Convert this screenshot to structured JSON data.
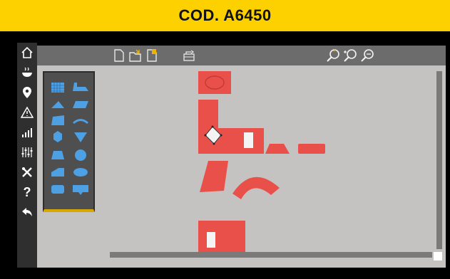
{
  "banner": {
    "title": "COD. A6450",
    "color": "#fdd000"
  },
  "left_toolbar": {
    "items": [
      {
        "icon": "home-icon"
      },
      {
        "icon": "bowl-steam-icon"
      },
      {
        "icon": "location-pin-icon"
      },
      {
        "icon": "warning-icon"
      },
      {
        "icon": "signal-strength-icon"
      },
      {
        "icon": "equalizer-icon"
      },
      {
        "icon": "tools-icon"
      },
      {
        "icon": "help-icon",
        "text": "?"
      },
      {
        "icon": "back-arrow-icon"
      }
    ]
  },
  "top_toolbar": {
    "file_icons": [
      "new-file-icon",
      "open-folder-icon",
      "save-file-icon"
    ],
    "extra_icon": "layout-icon",
    "zoom_icons": [
      "zoom-in-icon",
      "zoom-plus-icon",
      "zoom-fit-icon"
    ]
  },
  "shape_palette": {
    "rows": [
      [
        "grid-pattern-icon",
        "boot-shape-icon"
      ],
      [
        "triangle-shape-icon",
        "parallelogram-shape-icon"
      ],
      [
        "trapezoid-shape-icon",
        "arc-shape-icon"
      ],
      [
        "hexagon-shape-icon",
        "inverted-triangle-shape-icon"
      ],
      [
        "trapezoid-base-shape-icon",
        "circle-shape-icon"
      ],
      [
        "cut-rectangle-shape-icon",
        "ellipse-shape-icon"
      ],
      [
        "rounded-rectangle-shape-icon",
        "speech-bubble-shape-icon"
      ]
    ],
    "accent": "#d8a800"
  },
  "canvas": {
    "piece_color": "#e9504a",
    "background": "#c5c2c2"
  }
}
